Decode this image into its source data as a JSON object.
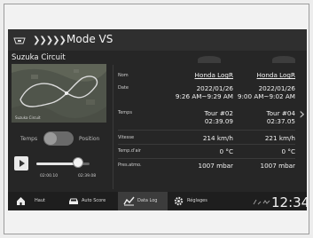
{
  "header": {
    "title": "Mode VS",
    "chevrons": "❯❯❯❯❯"
  },
  "circuit": "Suzuka Circuit",
  "map": {
    "label": "Suzuka Circuit"
  },
  "toggle": {
    "left": "Temps",
    "right": "Position"
  },
  "player": {
    "time_start": "02:00.10",
    "time_end": "02:39.08",
    "progress": 0.78
  },
  "table": {
    "labels": {
      "name": "Nom",
      "date": "Date",
      "temps": "Temps",
      "vitesse": "Vitesse",
      "temp_air": "Temp.d'air",
      "pression": "Pres.atmo."
    },
    "col1": {
      "name": "Honda LogR",
      "date_line1": "2022/01/26",
      "date_line2": "9:26 AM~9:29 AM",
      "tour": "Tour #02",
      "time": "02:39.09",
      "vitesse": "214 km/h",
      "temp_air": "0 °C",
      "pression": "1007 mbar"
    },
    "col2": {
      "name": "Honda LogR",
      "date_line1": "2022/01/26",
      "date_line2": "9:00 AM~9:02 AM",
      "tour": "Tour #04",
      "time": "02:37.05",
      "vitesse": "221 km/h",
      "temp_air": "0 °C",
      "pression": "1007 mbar"
    }
  },
  "nav": {
    "home": "Haut",
    "auto": "Auto Score",
    "datalog": "Data Log",
    "settings": "Réglages",
    "clock": "12:34"
  },
  "colors": {
    "screen_bg": "#262626",
    "nav_bg": "#1e1e1e",
    "active_tab": "#3c3c3c"
  }
}
